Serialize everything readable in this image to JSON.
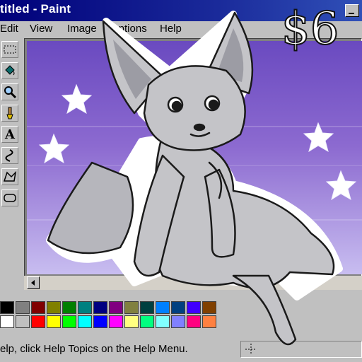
{
  "window": {
    "title": "titled - Paint",
    "controls": [
      "minimize-icon"
    ]
  },
  "menu": {
    "items": [
      "Edit",
      "View",
      "Image",
      "Options",
      "Help"
    ]
  },
  "toolbox": {
    "tools": [
      "select-rect-icon",
      "fill-bucket-icon",
      "magnifier-icon",
      "brush-icon",
      "text-tool-icon",
      "curve-tool-icon",
      "polygon-tool-icon",
      "rounded-rect-tool-icon"
    ],
    "text_tool_glyph": "A"
  },
  "canvas": {
    "price_text": "$6"
  },
  "palette": {
    "row1": [
      "#000000",
      "#808080",
      "#800000",
      "#808000",
      "#008000",
      "#008080",
      "#000080",
      "#800080",
      "#808040",
      "#004040",
      "#0080ff",
      "#004080",
      "#4000ff",
      "#804000"
    ],
    "row2": [
      "#ffffff",
      "#c0c0c0",
      "#ff0000",
      "#ffff00",
      "#00ff00",
      "#00ffff",
      "#0000ff",
      "#ff00ff",
      "#ffff80",
      "#00ff80",
      "#80ffff",
      "#8080ff",
      "#ff0080",
      "#ff8040"
    ]
  },
  "statusbar": {
    "text": "elp, click Help Topics on the Help Menu."
  },
  "colors": {
    "titlebar": "#00007a",
    "canvas_top": "#6a4ac0",
    "canvas_bottom": "#c8bdf0",
    "character_fur": "#c4c4c8"
  }
}
